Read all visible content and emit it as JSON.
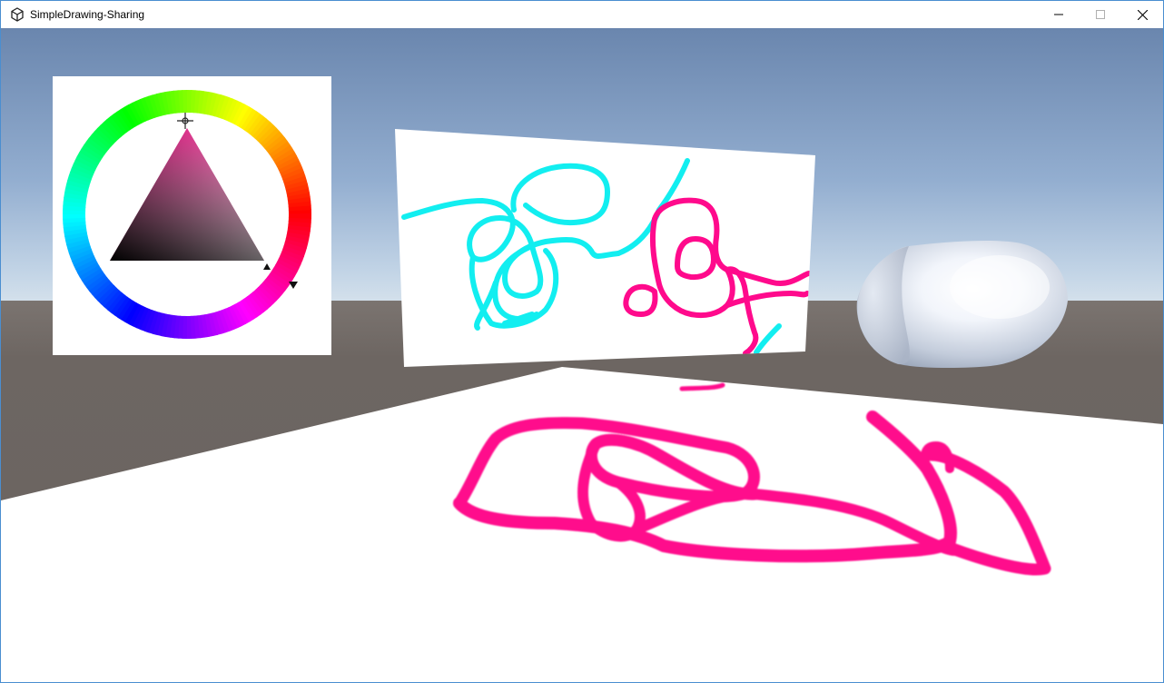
{
  "window": {
    "title": "SimpleDrawing-Sharing",
    "app_icon": "unity-icon",
    "controls": [
      "minimize-icon",
      "maximize-icon",
      "close-icon"
    ]
  },
  "scene": {
    "sky_top_color": "#6a86ae",
    "sky_horizon_color": "#bcd0e4",
    "ground_color": "#6b6460",
    "floor_color": "#ffffff",
    "ink_colors": {
      "magenta": "#ff0a8c",
      "cyan": "#12eef0"
    },
    "color_picker": {
      "selected_hue": "magenta",
      "selected_color": "#e0308c"
    },
    "objects": [
      "color-picker-panel",
      "drawing-canvas",
      "capsule",
      "floor-drawing"
    ]
  }
}
